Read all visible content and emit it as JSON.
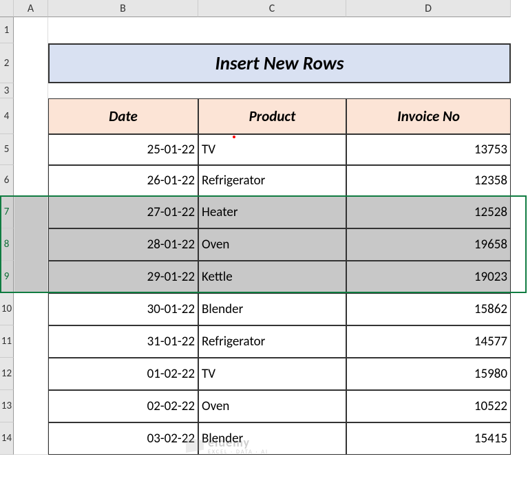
{
  "columns": {
    "A": "A",
    "B": "B",
    "C": "C",
    "D": "D"
  },
  "row_labels": [
    "1",
    "2",
    "3",
    "4",
    "5",
    "6",
    "7",
    "8",
    "9",
    "10",
    "11",
    "12",
    "13",
    "14"
  ],
  "title": "Insert New Rows",
  "headers": {
    "date": "Date",
    "product": "Product",
    "invoice": "Invoice No"
  },
  "rows": [
    {
      "date": "25-01-22",
      "product": "TV",
      "invoice": "13753"
    },
    {
      "date": "26-01-22",
      "product": "Refrigerator",
      "invoice": "12358"
    },
    {
      "date": "27-01-22",
      "product": "Heater",
      "invoice": "12528"
    },
    {
      "date": "28-01-22",
      "product": "Oven",
      "invoice": "19658"
    },
    {
      "date": "29-01-22",
      "product": "Kettle",
      "invoice": "19023"
    },
    {
      "date": "30-01-22",
      "product": "Blender",
      "invoice": "15862"
    },
    {
      "date": "31-01-22",
      "product": "Refrigerator",
      "invoice": "14577"
    },
    {
      "date": "01-02-22",
      "product": "TV",
      "invoice": "15980"
    },
    {
      "date": "02-02-22",
      "product": "Oven",
      "invoice": "10522"
    },
    {
      "date": "03-02-22",
      "product": "Blender",
      "invoice": "15415"
    }
  ],
  "watermark": {
    "line1": "eldemy",
    "line2": "EXCEL · DATA · AI"
  },
  "chart_data": {
    "type": "table",
    "title": "Insert New Rows",
    "columns": [
      "Date",
      "Product",
      "Invoice No"
    ],
    "records": [
      [
        "25-01-22",
        "TV",
        13753
      ],
      [
        "26-01-22",
        "Refrigerator",
        12358
      ],
      [
        "27-01-22",
        "Heater",
        12528
      ],
      [
        "28-01-22",
        "Oven",
        19658
      ],
      [
        "29-01-22",
        "Kettle",
        19023
      ],
      [
        "30-01-22",
        "Blender",
        15862
      ],
      [
        "31-01-22",
        "Refrigerator",
        14577
      ],
      [
        "01-02-22",
        "TV",
        15980
      ],
      [
        "02-02-22",
        "Oven",
        10522
      ],
      [
        "03-02-22",
        "Blender",
        15415
      ]
    ],
    "selected_rows": [
      3,
      4,
      5
    ]
  }
}
